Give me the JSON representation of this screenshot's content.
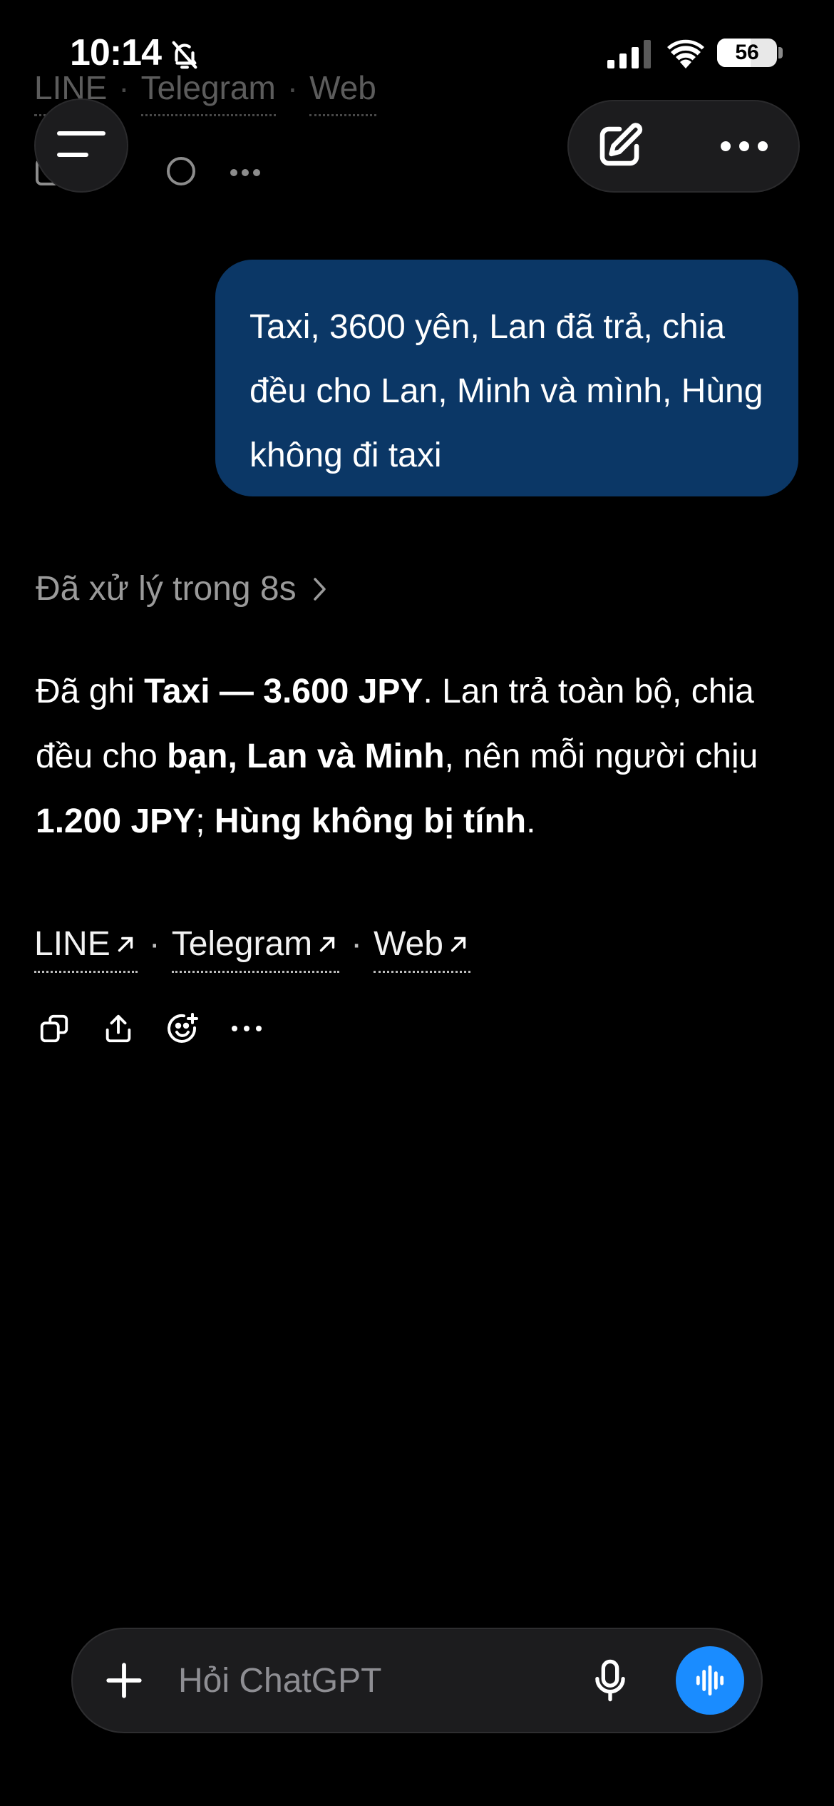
{
  "status_bar": {
    "time": "10:14",
    "battery_level": "56",
    "battery_fraction": 0.56,
    "icons": [
      "bell-slash-icon",
      "cellular-signal-icon",
      "wifi-icon",
      "battery-icon"
    ]
  },
  "header": {
    "icons": [
      "menu-icon",
      "compose-icon",
      "more-icon"
    ]
  },
  "user_message": {
    "text": "Taxi, 3600 yên, Lan đã trả, chia đều cho Lan, Minh và mình, Hùng không đi taxi"
  },
  "assistant": {
    "thought_label": "Đã xử lý trong 8s",
    "reply": {
      "p1": "Đã ghi ",
      "b1": "Taxi — 3.600 JPY",
      "p2": ". Lan trả toàn bộ, chia đều cho ",
      "b2": "bạn, Lan và Minh",
      "p3": ", nên mỗi người chịu ",
      "b3": "1.200 JPY",
      "p4": "; ",
      "b4": "Hùng không bị tính",
      "p5": "."
    },
    "links": [
      {
        "label": "LINE"
      },
      {
        "label": "Telegram"
      },
      {
        "label": "Web"
      }
    ],
    "separator": "·",
    "action_icons": [
      "copy-icon",
      "share-icon",
      "emoji-add-icon",
      "more-icon"
    ]
  },
  "composer": {
    "placeholder": "Hỏi ChatGPT",
    "icons": [
      "plus-icon",
      "microphone-icon",
      "voice-waveform-icon"
    ]
  },
  "colors": {
    "background": "#000000",
    "user_bubble": "#0b3766",
    "voice_button": "#1a8cff",
    "muted_text": "#9a9a9a"
  }
}
